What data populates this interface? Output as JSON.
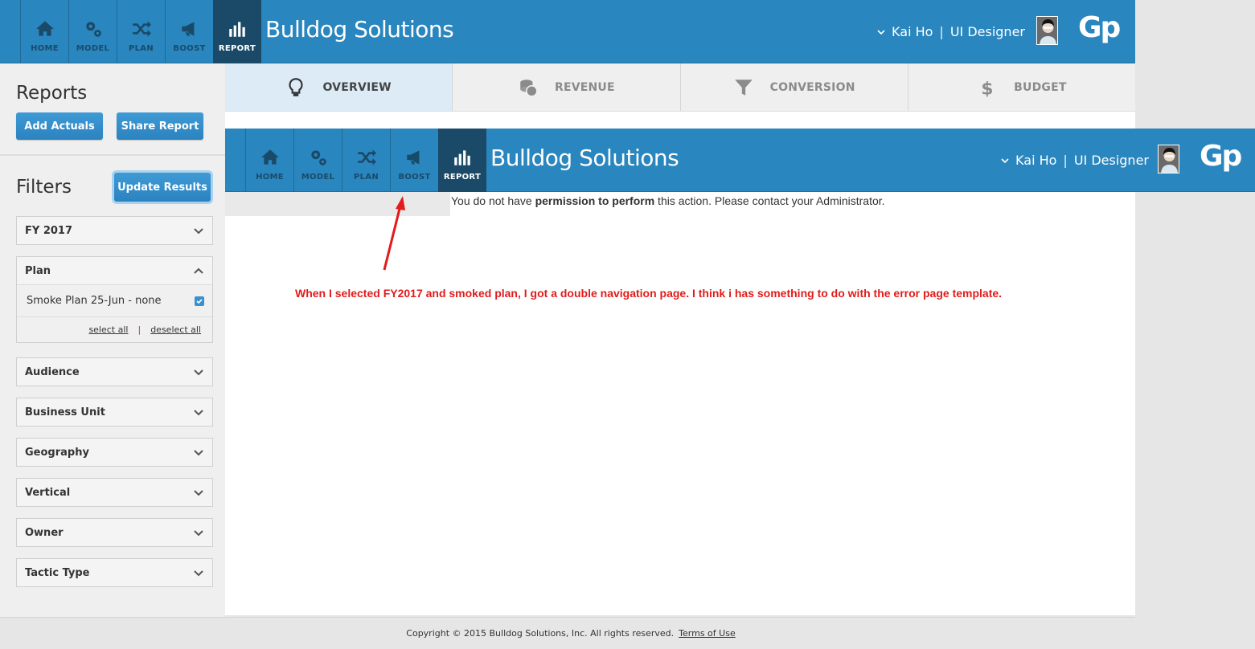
{
  "app": {
    "brand": "Bulldog Solutions",
    "user_name": "Kai Ho",
    "separator": "|",
    "user_role": "UI Designer",
    "logo": "Gp"
  },
  "nav": [
    {
      "label": "HOME",
      "icon": "home-icon",
      "active": false
    },
    {
      "label": "MODEL",
      "icon": "gears-icon",
      "active": false
    },
    {
      "label": "PLAN",
      "icon": "shuffle-icon",
      "active": false
    },
    {
      "label": "BOOST",
      "icon": "megaphone-icon",
      "active": false
    },
    {
      "label": "REPORT",
      "icon": "bar-chart-icon",
      "active": true
    }
  ],
  "tabs": [
    {
      "label": "OVERVIEW",
      "icon": "lightbulb-icon",
      "active": true
    },
    {
      "label": "REVENUE",
      "icon": "coins-icon",
      "active": false
    },
    {
      "label": "CONVERSION",
      "icon": "funnel-icon",
      "active": false
    },
    {
      "label": "BUDGET",
      "icon": "dollar-icon",
      "active": false
    }
  ],
  "sidebar": {
    "reports_title": "Reports",
    "add_actuals": "Add Actuals",
    "share_report": "Share Report",
    "filters_title": "Filters",
    "update_results": "Update Results",
    "filters": [
      {
        "label": "FY 2017",
        "expanded": false
      },
      {
        "label": "Plan",
        "expanded": true,
        "items": [
          {
            "label": "Smoke Plan 25-Jun - none",
            "checked": true
          }
        ],
        "select_all": "select all",
        "deselect_all": "deselect all",
        "divider": "|"
      },
      {
        "label": "Audience",
        "expanded": false
      },
      {
        "label": "Business Unit",
        "expanded": false
      },
      {
        "label": "Geography",
        "expanded": false
      },
      {
        "label": "Vertical",
        "expanded": false
      },
      {
        "label": "Owner",
        "expanded": false
      },
      {
        "label": "Tactic Type",
        "expanded": false
      }
    ]
  },
  "main": {
    "perm_prefix": "You do not have ",
    "perm_bold": "permission to perform",
    "perm_suffix": " this action. Please contact your Administrator.",
    "annotation": "When I selected FY2017 and smoked plan, I got a double navigation page. I think i has something to do with the error page template."
  },
  "footer": {
    "copyright": "Copyright © 2015 Bulldog Solutions, Inc. All rights reserved.",
    "terms": "Terms of Use"
  },
  "colors": {
    "nav_blue": "#2a86be",
    "nav_active": "#1b4a68",
    "button_blue": "#2b82bf",
    "annotation_red": "#e21b1b"
  }
}
